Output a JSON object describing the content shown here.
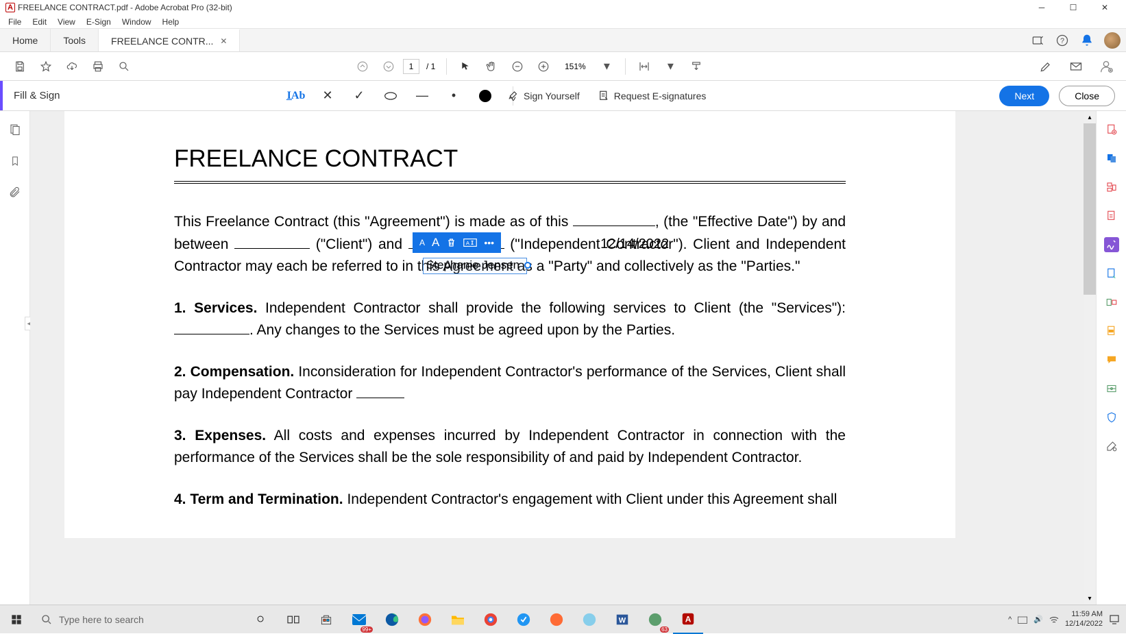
{
  "titlebar": {
    "title": "FREELANCE CONTRACT.pdf - Adobe Acrobat Pro (32-bit)"
  },
  "menu": {
    "file": "File",
    "edit": "Edit",
    "view": "View",
    "esign": "E-Sign",
    "window": "Window",
    "help": "Help"
  },
  "tabs": {
    "home": "Home",
    "tools": "Tools",
    "doc": "FREELANCE CONTR..."
  },
  "toolbar": {
    "page_current": "1",
    "page_total": "/ 1",
    "zoom": "151%"
  },
  "fillsign": {
    "label": "Fill & Sign",
    "sign_yourself": "Sign Yourself",
    "request": "Request E-signatures",
    "next": "Next",
    "close": "Close"
  },
  "document": {
    "heading": "FREELANCE CONTRACT",
    "intro_a": "This Freelance Contract (this \"Agreement\") is made as of this ",
    "intro_b": ", (the \"Effective Date\") by and between ",
    "intro_c": " (\"Client\") and ",
    "intro_d": " (\"Independent Contractor\"). Client and Independent Contractor may each be referred to in this Agreement as a \"Party\" and collectively as the \"Parties.\"",
    "s1_a": "1.  Services.",
    "s1_b": " Independent Contractor shall provide the following services to Client (the \"Services\"): ",
    "s1_c": ". Any changes to the Services must be agreed upon by the Parties.",
    "s2_a": "2. Compensation.",
    "s2_b": " Inconsideration for Independent Contractor's performance of the Services, Client shall pay Independent Contractor ",
    "s3_a": "3. Expenses.",
    "s3_b": " All costs and expenses incurred by Independent Contractor in connection with the performance of the Services shall be the sole responsibility of and paid by Independent Contractor.",
    "s4_a": "4. Term and Termination.",
    "s4_b": " Independent Contractor's engagement with Client under this Agreement shall"
  },
  "fields": {
    "date": "12/14/2022",
    "contractor_name": "Stephanie Jensen"
  },
  "taskbar": {
    "search_placeholder": "Type here to search",
    "badge": "99+",
    "time": "11:59 AM",
    "date": "12/14/2022"
  }
}
